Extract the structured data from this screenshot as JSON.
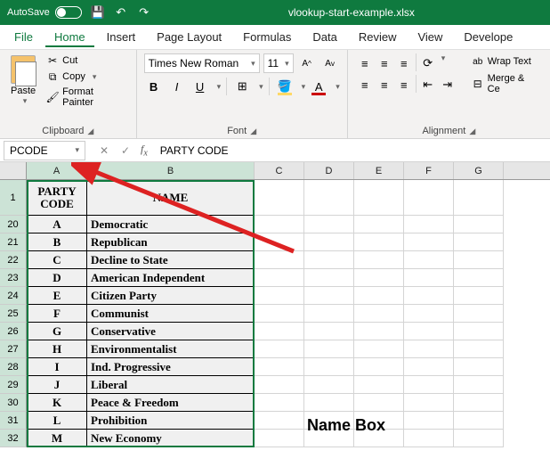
{
  "titlebar": {
    "autosave_label": "AutoSave",
    "filename": "vlookup-start-example.xlsx"
  },
  "menu": {
    "file": "File",
    "home": "Home",
    "insert": "Insert",
    "page_layout": "Page Layout",
    "formulas": "Formulas",
    "data": "Data",
    "review": "Review",
    "view": "View",
    "developer": "Develope"
  },
  "ribbon": {
    "clipboard": {
      "paste": "Paste",
      "cut": "Cut",
      "copy": "Copy",
      "format_painter": "Format Painter",
      "label": "Clipboard"
    },
    "font": {
      "name": "Times New Roman",
      "size": "11",
      "label": "Font"
    },
    "alignment": {
      "wrap": "Wrap Text",
      "merge": "Merge & Ce",
      "label": "Alignment"
    }
  },
  "formula_bar": {
    "name_box": "PCODE",
    "formula": "PARTY CODE"
  },
  "columns": [
    "A",
    "B",
    "C",
    "D",
    "E",
    "F",
    "G"
  ],
  "header_row": "1",
  "table_header": {
    "code": "PARTY CODE",
    "name": "NAME"
  },
  "rows": [
    {
      "n": "20",
      "code": "A",
      "name": "Democratic"
    },
    {
      "n": "21",
      "code": "B",
      "name": "Republican"
    },
    {
      "n": "22",
      "code": "C",
      "name": "Decline to State"
    },
    {
      "n": "23",
      "code": "D",
      "name": "American Independent"
    },
    {
      "n": "24",
      "code": "E",
      "name": "Citizen Party"
    },
    {
      "n": "25",
      "code": "F",
      "name": "Communist"
    },
    {
      "n": "26",
      "code": "G",
      "name": "Conservative"
    },
    {
      "n": "27",
      "code": "H",
      "name": "Environmentalist"
    },
    {
      "n": "28",
      "code": "I",
      "name": "Ind. Progressive"
    },
    {
      "n": "29",
      "code": "J",
      "name": "Liberal"
    },
    {
      "n": "30",
      "code": "K",
      "name": "Peace & Freedom"
    },
    {
      "n": "31",
      "code": "L",
      "name": "Prohibition"
    },
    {
      "n": "32",
      "code": "M",
      "name": "New Economy"
    }
  ],
  "annotation": "Name Box"
}
